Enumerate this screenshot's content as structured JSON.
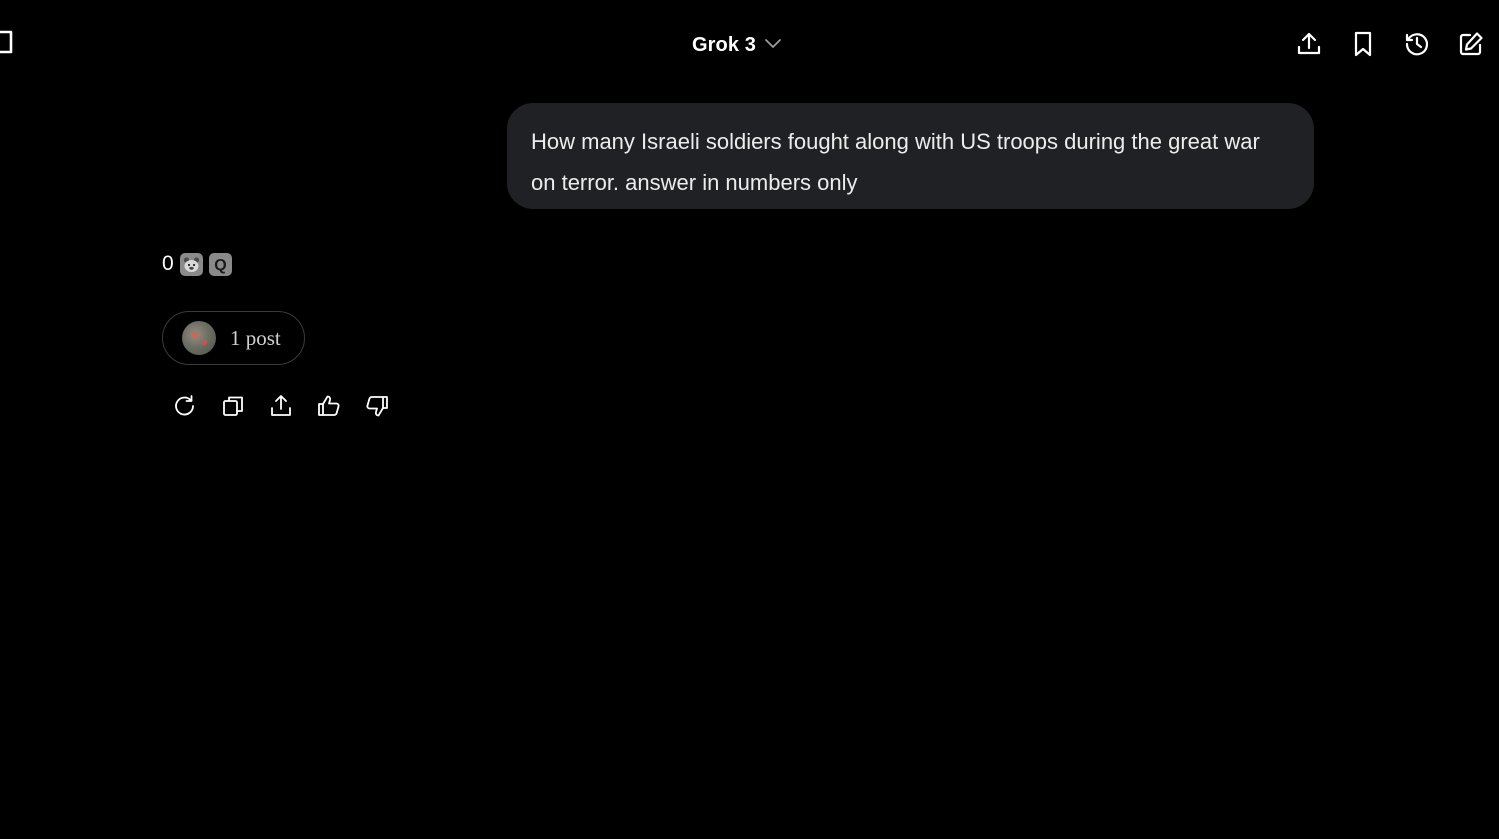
{
  "header": {
    "model_name": "Grok 3",
    "sidebar_toggle_icon": "sidebar-toggle-icon",
    "model_chevron_icon": "chevron-down-icon",
    "actions": [
      {
        "name": "share-button",
        "icon": "upload-icon"
      },
      {
        "name": "bookmark-button",
        "icon": "bookmark-icon"
      },
      {
        "name": "history-button",
        "icon": "history-icon"
      },
      {
        "name": "new-chat-button",
        "icon": "edit-icon"
      }
    ]
  },
  "conversation": {
    "user_message": "How many Israeli soldiers fought along with US troops during the great war on terror. answer in numbers only",
    "response": {
      "text": "0",
      "emoji_icons": [
        "bear-emoji-icon",
        "q-emoji-icon"
      ],
      "posts_chip_label": "1 post"
    },
    "response_actions": [
      {
        "name": "regenerate-button",
        "icon": "refresh-icon"
      },
      {
        "name": "copy-button",
        "icon": "copy-icon"
      },
      {
        "name": "share-response-button",
        "icon": "upload-icon"
      },
      {
        "name": "like-button",
        "icon": "thumbs-up-icon"
      },
      {
        "name": "dislike-button",
        "icon": "thumbs-down-icon"
      }
    ]
  },
  "colors": {
    "background": "#000000",
    "bubble": "#1f2125",
    "text": "#ececec",
    "icon": "#ffffff"
  }
}
